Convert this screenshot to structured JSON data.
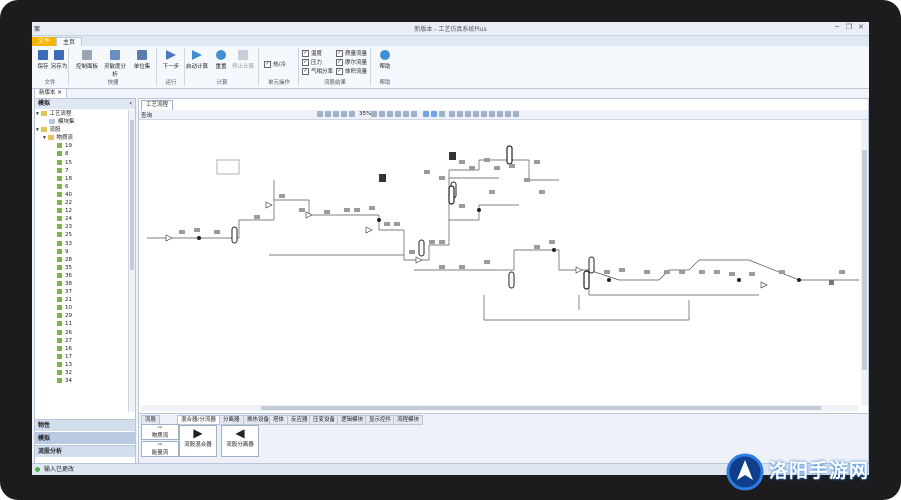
{
  "app": {
    "title_left": "案",
    "title": "新版本 - 工艺仿真系统Plus",
    "minimize": "─",
    "restore": "❐",
    "close": "✕"
  },
  "tabs": [
    {
      "label": "文件"
    },
    {
      "label": "主页"
    }
  ],
  "ribbon": {
    "groups": [
      {
        "label": "文件",
        "buttons": [
          "保存",
          "另存为"
        ]
      },
      {
        "label": "快捷",
        "buttons": [
          "控制面板",
          "灵敏度分析",
          "单位集"
        ]
      },
      {
        "label": "运行",
        "buttons": [
          "下一步"
        ]
      },
      {
        "label": "计算",
        "buttons": [
          "启动计算",
          "重置",
          "停止计算"
        ]
      },
      {
        "label": "单元操作",
        "checks": [
          "热/冷"
        ]
      },
      {
        "label": "流股结果",
        "checks": [
          "温度",
          "压力",
          "气相分率",
          "质量流量",
          "摩尔流量",
          "体积流量"
        ]
      },
      {
        "label": "帮助",
        "buttons": [
          "帮助"
        ]
      }
    ]
  },
  "document_tab": "新版本",
  "left_panel": {
    "header": "模拟",
    "tree_root": "工艺流程",
    "tree_sub": "模块集",
    "tree_streams": "流股",
    "tree_stream_group": "物质流",
    "stream_ids": [
      "19",
      "8",
      "15",
      "7",
      "18",
      "6",
      "40",
      "22",
      "12",
      "24",
      "23",
      "25",
      "33",
      "9",
      "28",
      "35",
      "36",
      "38",
      "37",
      "21",
      "10",
      "29",
      "11",
      "26",
      "27",
      "16",
      "17",
      "13",
      "32",
      "34"
    ],
    "sections": [
      "物性",
      "模拟",
      "流股分析"
    ]
  },
  "main": {
    "tab": "工艺流程",
    "subtab": "查询",
    "zoom": "35%",
    "palette": {
      "tabs": [
        "流股",
        "混合器/分流器",
        "分离器",
        "换热设备",
        "塔体",
        "反应器",
        "压变设备",
        "逻辑模块",
        "显示控件",
        "流程模块"
      ],
      "left_items": [
        "物质流",
        "能量流"
      ],
      "items": [
        "流股混合器",
        "流股分离器"
      ]
    }
  },
  "status": {
    "text": "输入已更改"
  },
  "watermark": {
    "text": "洛阳手游网"
  },
  "colors": {
    "ribbon_accent": "#f4b400",
    "tree_stream": "#7ab648",
    "watermark_blue": "#1a6fd6"
  }
}
